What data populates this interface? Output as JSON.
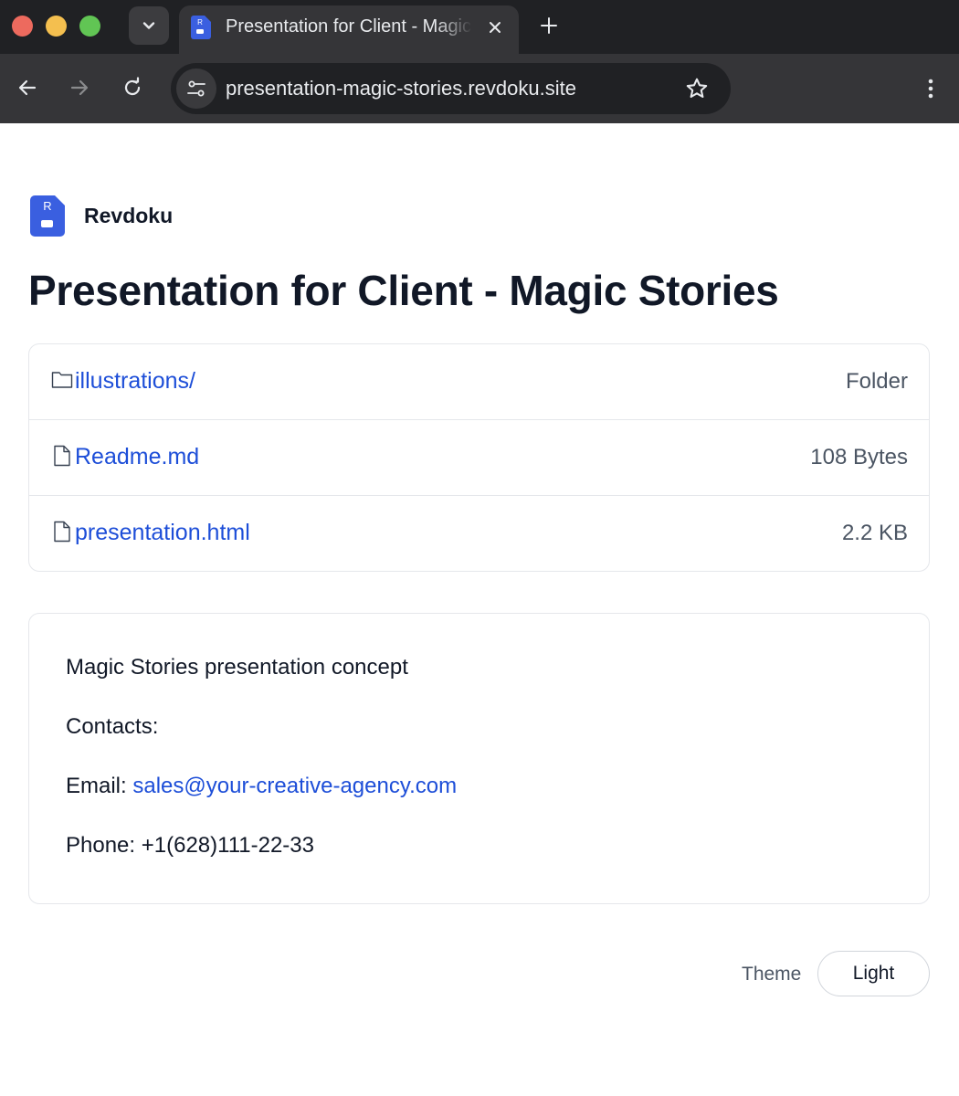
{
  "browser": {
    "tab": {
      "title": "Presentation for Client - Magic Stories"
    },
    "address_bar": {
      "url": "presentation-magic-stories.revdoku.site"
    }
  },
  "brand": {
    "logo_letter": "R",
    "name": "Revdoku"
  },
  "page": {
    "title": "Presentation for Client - Magic Stories"
  },
  "files": [
    {
      "name": "illustrations/",
      "meta": "Folder",
      "icon": "folder-icon"
    },
    {
      "name": "Readme.md",
      "meta": "108 Bytes",
      "icon": "file-icon"
    },
    {
      "name": "presentation.html",
      "meta": "2.2 KB",
      "icon": "file-icon"
    }
  ],
  "readme": {
    "line1": "Magic Stories presentation concept",
    "contacts": "Contacts:",
    "email_label": "Email: ",
    "email": "sales@your-creative-agency.com",
    "phone": "Phone: +1(628)111-22-33"
  },
  "theme": {
    "label": "Theme",
    "value": "Light"
  },
  "colors": {
    "brand": "#3a5fe0",
    "link": "#1d4ed8",
    "chrome_dark": "#202124",
    "chrome_toolbar": "#353538"
  }
}
